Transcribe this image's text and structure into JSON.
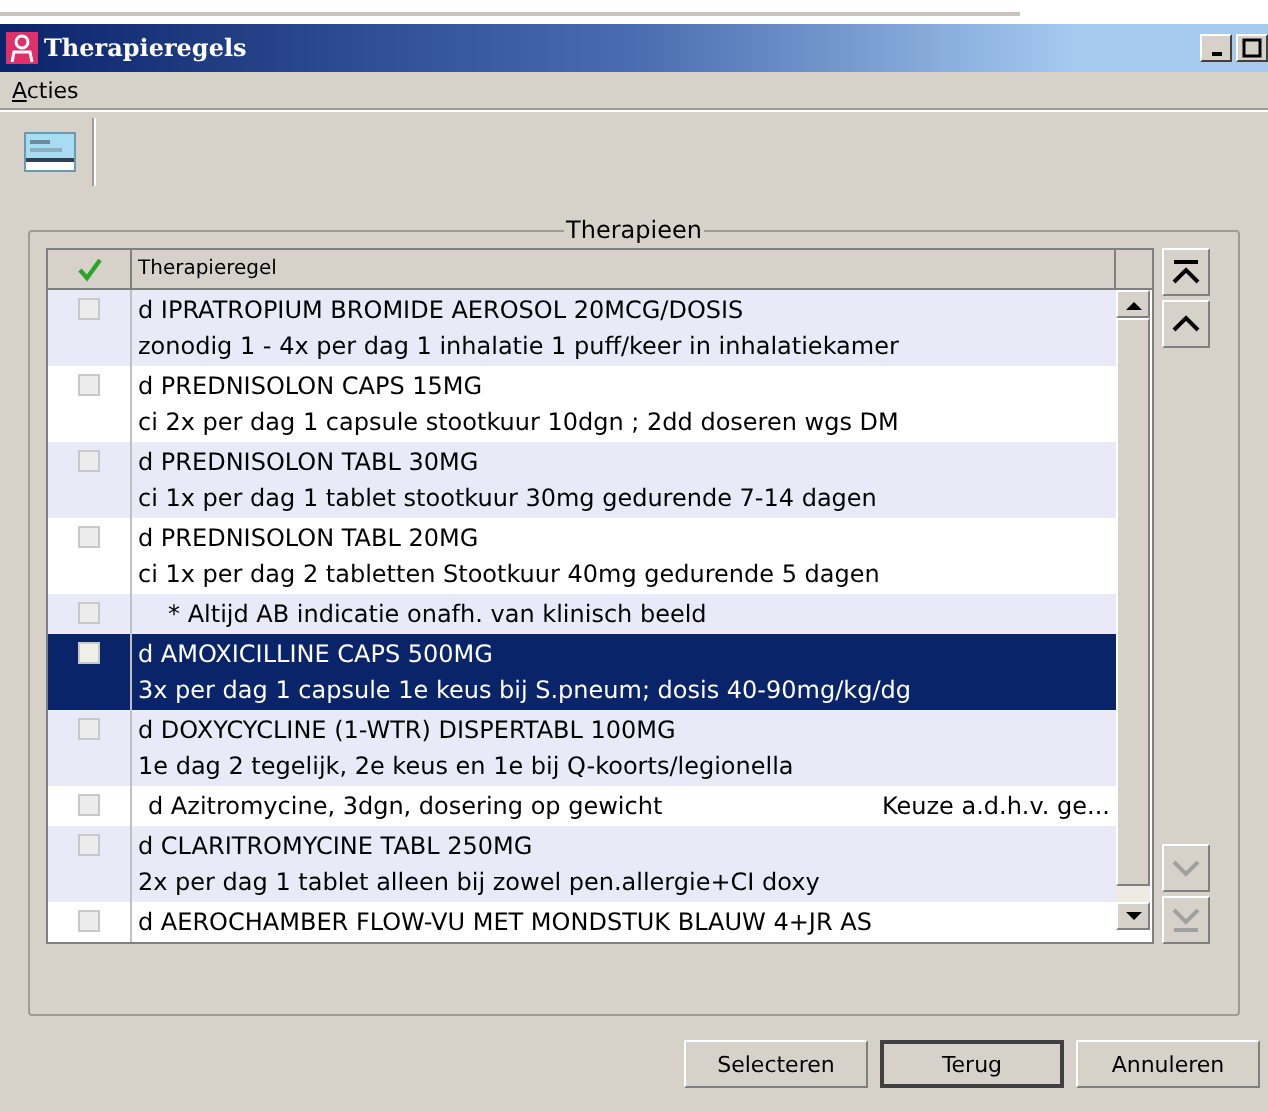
{
  "window": {
    "title": "Therapieregels"
  },
  "menu": [
    {
      "label": "Acties"
    }
  ],
  "group": {
    "title": "Therapieen"
  },
  "table": {
    "columns": [
      {
        "kind": "check"
      },
      {
        "kind": "text",
        "label": "Therapieregel"
      }
    ],
    "rows": [
      {
        "kind": "entry",
        "checked": false,
        "selected": false,
        "lines": [
          "d IPRATROPIUM BROMIDE AEROSOL 20MCG/DOSIS",
          "zonodig 1 - 4x per dag 1 inhalatie 1 puff/keer in inhalatiekamer"
        ]
      },
      {
        "kind": "entry",
        "checked": false,
        "selected": false,
        "lines": [
          "d PREDNISOLON CAPS 15MG",
          "ci 2x per dag 1 capsule stootkuur 10dgn ; 2dd doseren wgs DM"
        ]
      },
      {
        "kind": "entry",
        "checked": false,
        "selected": false,
        "lines": [
          "d PREDNISOLON TABL 30MG",
          "ci 1x per dag 1 tablet stootkuur 30mg gedurende 7-14 dagen"
        ]
      },
      {
        "kind": "entry",
        "checked": false,
        "selected": false,
        "lines": [
          "d PREDNISOLON TABL 20MG",
          "ci 1x per dag 2 tabletten Stootkuur 40mg gedurende 5 dagen"
        ]
      },
      {
        "kind": "note",
        "checked": false,
        "selected": false,
        "lines": [
          "* Altijd AB indicatie onafh. van klinisch beeld"
        ]
      },
      {
        "kind": "entry",
        "checked": false,
        "selected": true,
        "lines": [
          "d AMOXICILLINE CAPS 500MG",
          "3x per dag 1 capsule 1e keus bij S.pneum; dosis 40-90mg/kg/dg"
        ]
      },
      {
        "kind": "entry",
        "checked": false,
        "selected": false,
        "lines": [
          "d DOXYCYCLINE (1-WTR) DISPERTABL 100MG",
          "1e dag 2 tegelijk, 2e keus en 1e bij Q-koorts/legionella"
        ]
      },
      {
        "kind": "split",
        "checked": false,
        "selected": false,
        "lines": [
          "d  Azitromycine, 3dgn, dosering op gewicht",
          "Keuze a.d.h.v. ge..."
        ]
      },
      {
        "kind": "entry",
        "checked": false,
        "selected": false,
        "lines": [
          "d CLARITROMYCINE TABL 250MG",
          "2x per dag 1 tablet alleen bij zowel pen.allergie+CI doxy"
        ]
      },
      {
        "kind": "entry",
        "checked": false,
        "selected": false,
        "lines": [
          "d AEROCHAMBER FLOW-VU MET MONDSTUK BLAUW 4+JR AS"
        ]
      }
    ]
  },
  "buttons": [
    {
      "label": "Selecteren",
      "default": false
    },
    {
      "label": "Terug",
      "default": true
    },
    {
      "label": "Annuleren",
      "default": false
    }
  ]
}
